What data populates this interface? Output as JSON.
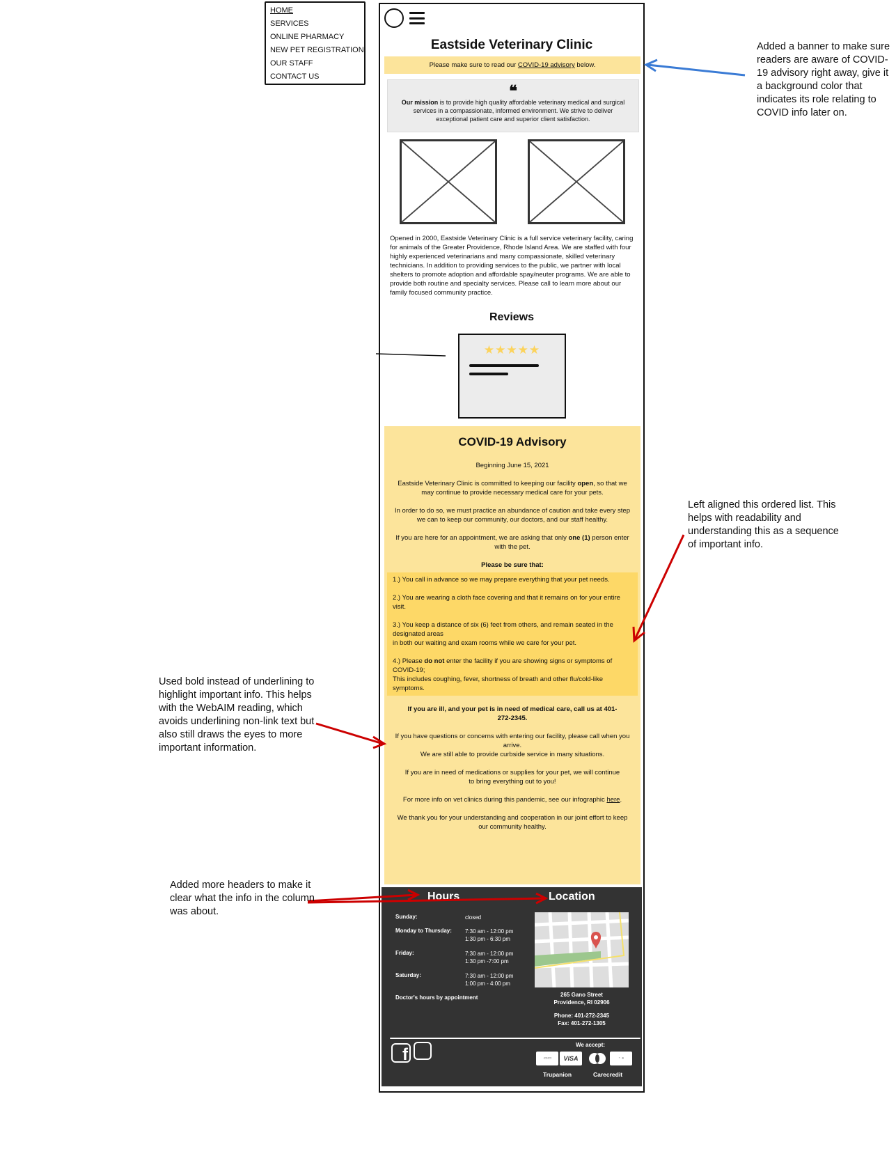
{
  "nav": {
    "items": [
      "HOME",
      "SERVICES",
      "ONLINE PHARMACY",
      "NEW PET REGISTRATION",
      "OUR STAFF",
      "CONTACT US"
    ]
  },
  "site": {
    "title": "Eastside Veterinary Clinic",
    "banner_pre": "Please make sure to read our ",
    "banner_link": "COVID-19 advisory",
    "banner_post": " below."
  },
  "mission": {
    "lead": "Our mission",
    "text": " is to provide high quality affordable veterinary medical and surgical services in a compassionate, informed environment. We strive to deliver exceptional patient care and superior client satisfaction."
  },
  "about": "Opened in 2000, Eastside Veterinary Clinic is a full service veterinary facility, caring for animals of the Greater Providence, Rhode Island Area. We are staffed with four highly experienced veterinarians and many compassionate, skilled veterinary technicians. In addition to providing services to the public, we partner with local shelters to promote adoption and affordable spay/neuter programs. We are able to provide both routine and specialty services. Please call to learn more about our family focused  community practice.",
  "reviews": {
    "title": "Reviews",
    "rating": 5,
    "stars": "★★★★★"
  },
  "covid": {
    "title": "COVID-19 Advisory",
    "date": "Beginning June 15, 2021",
    "p1_pre": "Eastside Veterinary Clinic is committed to keeping our facility ",
    "p1_bold": "open",
    "p1_post": ", so that we may continue to provide necessary medical care for your pets.",
    "p2": "In order to do so, we must practice an abundance of caution and take every step we can to keep our community, our doctors, and our staff healthy.",
    "p3_pre": "If you are here for an appointment, we are asking that only ",
    "p3_bold": "one (1)",
    "p3_post": " person enter with the pet.",
    "list_head": "Please be sure that:",
    "li1": "1.) You call in advance so we may prepare everything that your pet needs.",
    "li2": "2.)  You are wearing a cloth face covering and that it remains on for your entire visit.",
    "li3a": "3.)  You keep a distance of six (6) feet from others, and remain seated in the designated areas",
    "li3b": "in both our waiting and exam rooms while we care for your pet.",
    "li4_pre": "4.)  Please ",
    "li4_bold": "do not",
    "li4_post": " enter the facility if you are showing signs or symptoms of COVID-19;",
    "li4b": "This includes coughing, fever, shortness of  breath and other flu/cold-like symptoms.",
    "ill": "If you are ill, and your pet is in need of medical care, call us at 401-272-2345.",
    "p4a": "If you have questions or concerns with entering our facility, please call when you arrive.",
    "p4b": "We are still able to provide curbside service in many situations.",
    "p5": "If you are in need of medications or supplies for your pet, we will continue to bring everything out to you!",
    "p6_pre": "For more info on vet clinics during this pandemic, see our infographic ",
    "p6_link": "here",
    "p6_post": ".",
    "p7": "We thank you for your understanding and cooperation in our joint effort to keep our community healthy."
  },
  "footer": {
    "hours_title": "Hours",
    "location_title": "Location",
    "hours": [
      {
        "day": "Sunday:",
        "time1": "closed",
        "time2": ""
      },
      {
        "day": "Monday to Thursday:",
        "time1": "7:30 am - 12:00 pm",
        "time2": "1:30 pm - 6:30 pm"
      },
      {
        "day": "Friday:",
        "time1": "7:30 am - 12:00 pm",
        "time2": "1:30 pm -7:00 pm"
      },
      {
        "day": "Saturday:",
        "time1": "7:30 am - 12:00 pm",
        "time2": "1:00 pm - 4:00 pm"
      }
    ],
    "doctor_note": "Doctor's hours by appointment",
    "address1": "265 Gano Street",
    "address2": "Providence, RI  02906",
    "phone": "Phone: 401-272-2345",
    "fax": "Fax: 401-272-1305",
    "we_accept": "We accept:",
    "card_visa": "VISA",
    "trupanion": "Trupanion",
    "carecredit": "Carecredit"
  },
  "annotations": {
    "banner_note": "Added a banner to make sure readers are aware of COVID-19 advisory right away, give it a background color that indicates its role relating to COVID info later on.",
    "list_note": "Left aligned this ordered list. This helps with readability and understanding this as a sequence of important info.",
    "bold_note": "Used bold instead of underlining to highlight important info. This helps with the WebAIM reading, which avoids underlining non-link text but also still draws the eyes to more important information.",
    "headers_note": "Added more headers to make it clear what the info in the column was about."
  },
  "colors": {
    "banner": "#fce49b",
    "list_bg": "#fdd867",
    "footer": "#333333",
    "arrow_blue": "#3a7bd5",
    "arrow_red": "#cc0000",
    "stars": "#fcd35b"
  }
}
